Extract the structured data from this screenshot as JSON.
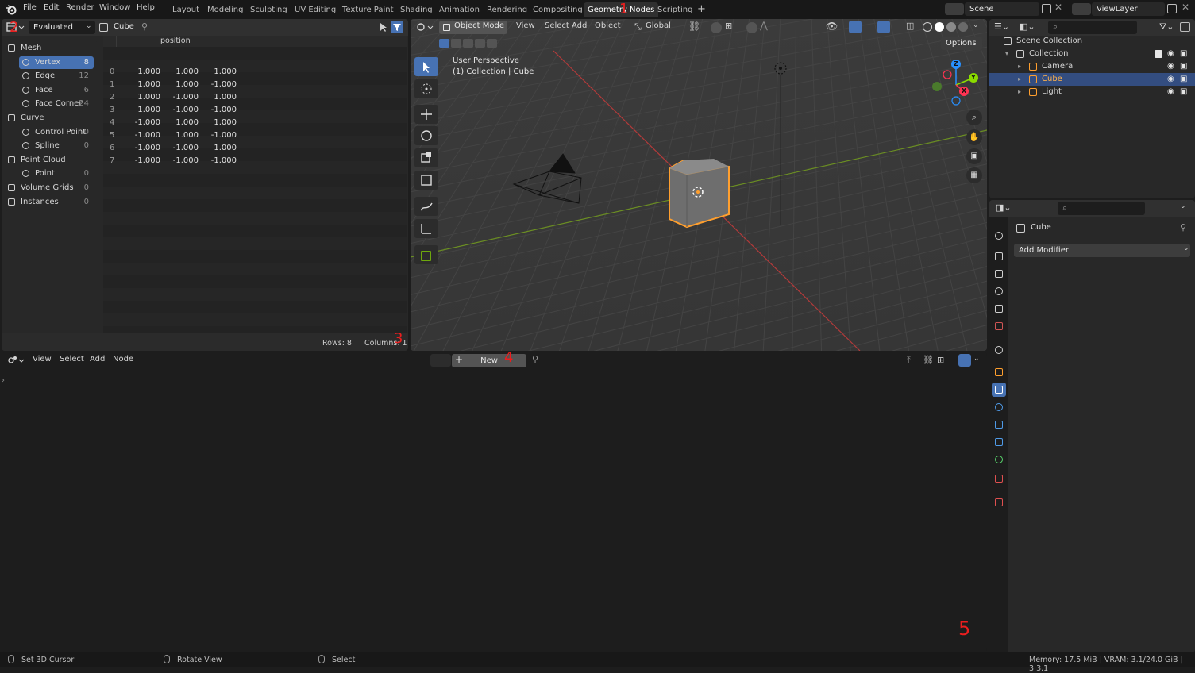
{
  "app": {
    "menu": [
      "File",
      "Edit",
      "Render",
      "Window",
      "Help"
    ],
    "workspaces": [
      "Layout",
      "Modeling",
      "Sculpting",
      "UV Editing",
      "Texture Paint",
      "Shading",
      "Animation",
      "Rendering",
      "Compositing",
      "Geometry Nodes",
      "Scripting",
      "+"
    ],
    "active_workspace": "Geometry Nodes",
    "scene": "Scene",
    "view_layer": "ViewLayer"
  },
  "markers": [
    "1",
    "2",
    "3",
    "4",
    "5"
  ],
  "spreadsheet": {
    "mode": "Evaluated",
    "object": "Cube",
    "column_header": "position",
    "domains": [
      {
        "label": "Mesh",
        "count": "",
        "level": 0,
        "icon": "mesh-icon"
      },
      {
        "label": "Vertex",
        "count": "8",
        "level": 1,
        "icon": "vertex-icon",
        "selected": true
      },
      {
        "label": "Edge",
        "count": "12",
        "level": 1,
        "icon": "edge-icon"
      },
      {
        "label": "Face",
        "count": "6",
        "level": 1,
        "icon": "face-icon"
      },
      {
        "label": "Face Corner",
        "count": "24",
        "level": 1,
        "icon": "face-corner-icon"
      },
      {
        "label": "Curve",
        "count": "",
        "level": 0,
        "icon": "curve-icon"
      },
      {
        "label": "Control Point",
        "count": "0",
        "level": 1,
        "icon": "control-point-icon"
      },
      {
        "label": "Spline",
        "count": "0",
        "level": 1,
        "icon": "spline-icon"
      },
      {
        "label": "Point Cloud",
        "count": "",
        "level": 0,
        "icon": "point-cloud-icon"
      },
      {
        "label": "Point",
        "count": "0",
        "level": 1,
        "icon": "point-icon"
      },
      {
        "label": "Volume Grids",
        "count": "0",
        "level": 0,
        "icon": "volume-icon"
      },
      {
        "label": "Instances",
        "count": "0",
        "level": 0,
        "icon": "instances-icon"
      }
    ],
    "rows": [
      [
        "0",
        "1.000",
        "1.000",
        "1.000"
      ],
      [
        "1",
        "1.000",
        "1.000",
        "-1.000"
      ],
      [
        "2",
        "1.000",
        "-1.000",
        "1.000"
      ],
      [
        "3",
        "1.000",
        "-1.000",
        "-1.000"
      ],
      [
        "4",
        "-1.000",
        "1.000",
        "1.000"
      ],
      [
        "5",
        "-1.000",
        "1.000",
        "-1.000"
      ],
      [
        "6",
        "-1.000",
        "-1.000",
        "1.000"
      ],
      [
        "7",
        "-1.000",
        "-1.000",
        "-1.000"
      ]
    ],
    "footer_rows": "Rows: 8",
    "footer_sep": "|",
    "footer_cols": "Columns: 1"
  },
  "viewport": {
    "mode": "Object Mode",
    "menus": [
      "View",
      "Select",
      "Add",
      "Object"
    ],
    "orientation": "Global",
    "options": "Options",
    "overlay_line1": "User Perspective",
    "overlay_line2": "(1) Collection | Cube",
    "gizmo_labels": [
      "Z",
      "Y",
      "X"
    ]
  },
  "node_editor": {
    "menus": [
      "View",
      "Select",
      "Add",
      "Node"
    ],
    "new_button": "New"
  },
  "outliner": {
    "items": [
      {
        "label": "Scene Collection",
        "level": 0,
        "icon": "scene-collection-icon"
      },
      {
        "label": "Collection",
        "level": 1,
        "icon": "collection-icon"
      },
      {
        "label": "Camera",
        "level": 2,
        "icon": "camera-object-icon"
      },
      {
        "label": "Cube",
        "level": 2,
        "icon": "mesh-object-icon",
        "selected": true
      },
      {
        "label": "Light",
        "level": 2,
        "icon": "light-object-icon"
      }
    ]
  },
  "properties": {
    "object": "Cube",
    "add_modifier": "Add Modifier"
  },
  "statusbar": {
    "left": "Set 3D Cursor",
    "middle": "Rotate View",
    "right": "Select",
    "memory": "Memory: 17.5 MiB | VRAM: 3.1/24.0 GiB | 3.3.1"
  },
  "colors": {
    "accent": "#4772b3",
    "selection": "#ff9f2e",
    "axis_x": "#ff3352",
    "axis_y": "#8bdc00",
    "axis_z": "#2890ff",
    "marker": "#ea1e1e"
  }
}
